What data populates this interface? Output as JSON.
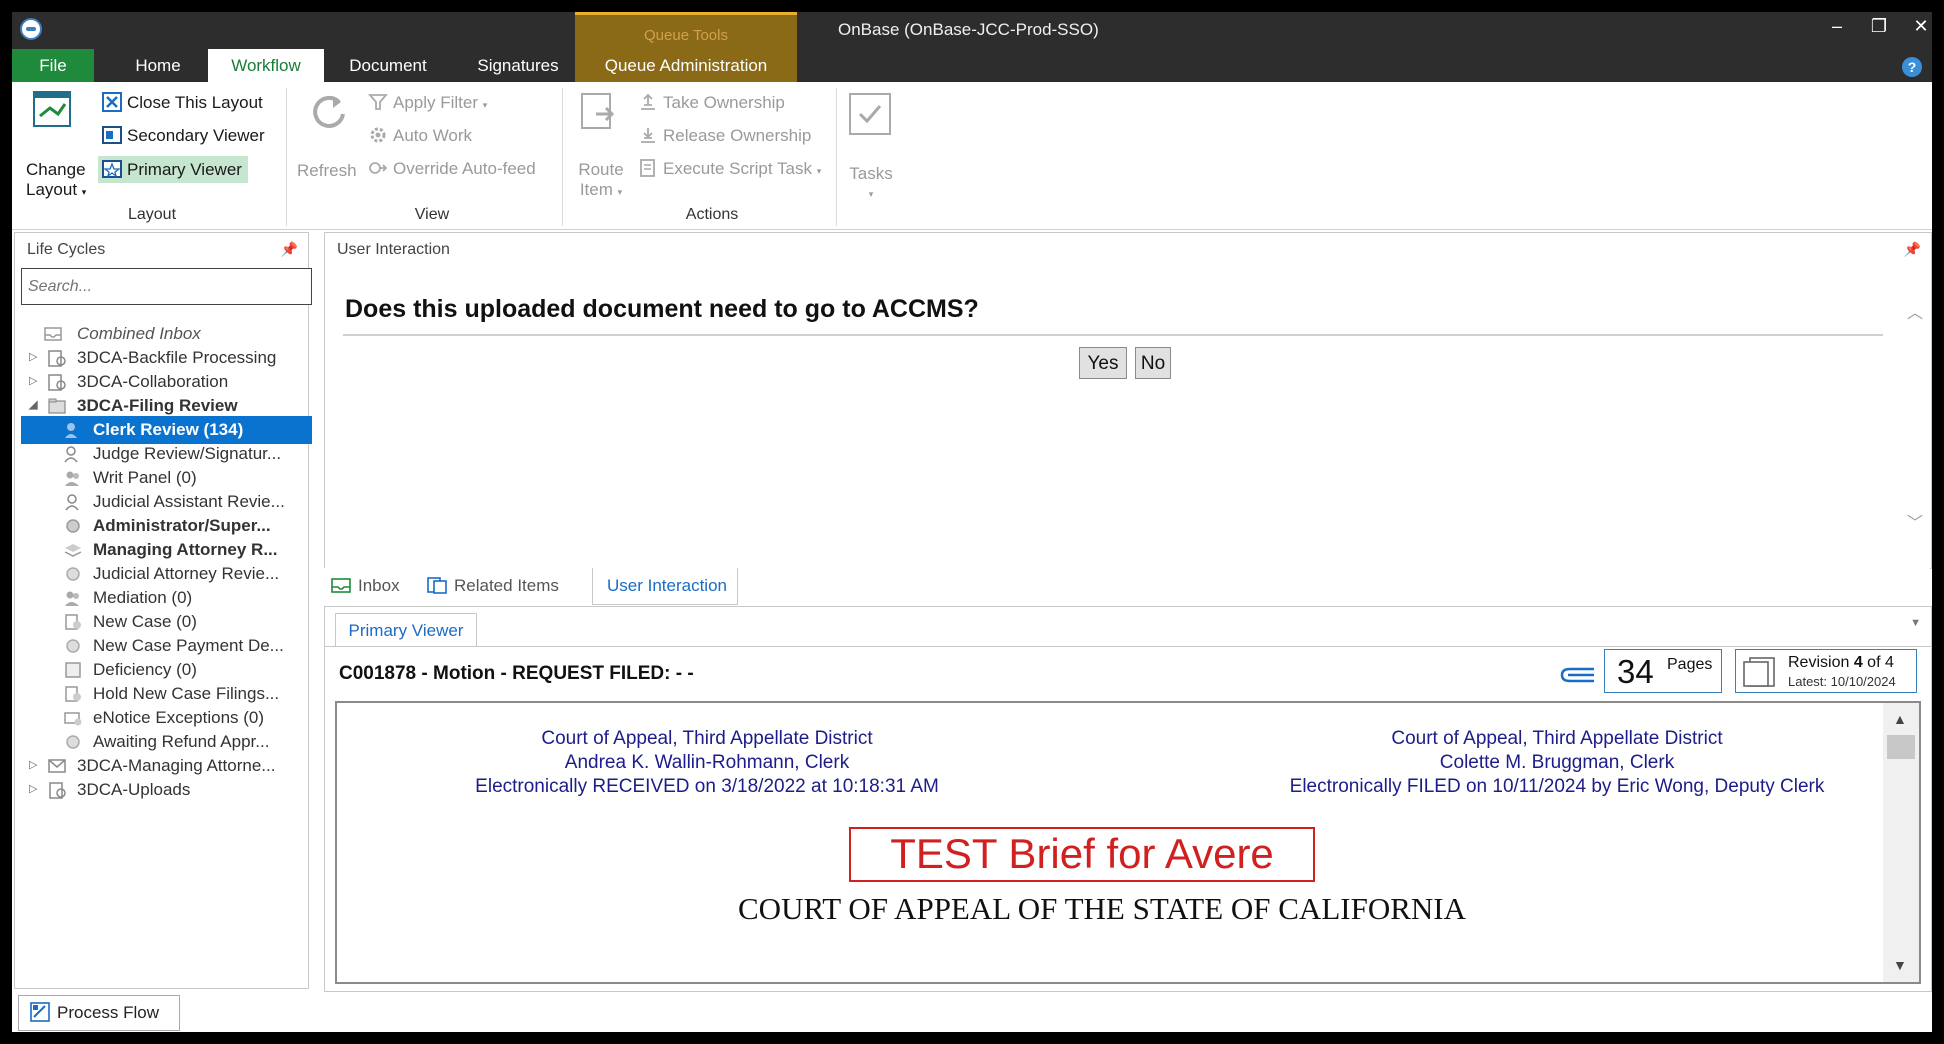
{
  "window": {
    "title": "OnBase (OnBase-JCC-Prod-SSO)",
    "context_group": "Queue Tools",
    "controls": {
      "minimize": "–",
      "restore": "❐",
      "close": "✕"
    }
  },
  "tabs": {
    "file": "File",
    "home": "Home",
    "workflow": "Workflow",
    "document": "Document",
    "signatures": "Signatures",
    "queue_admin": "Queue Administration",
    "help": "?"
  },
  "ribbon": {
    "layout": {
      "change_layout_1": "Change",
      "change_layout_2": "Layout",
      "close_layout": "Close This Layout",
      "secondary_viewer": "Secondary Viewer",
      "primary_viewer": "Primary Viewer",
      "group": "Layout"
    },
    "view": {
      "refresh": "Refresh",
      "apply_filter": "Apply Filter",
      "auto_work": "Auto Work",
      "override_autofeed": "Override Auto-feed",
      "group": "View"
    },
    "actions": {
      "route_item_1": "Route",
      "route_item_2": "Item",
      "take_ownership": "Take Ownership",
      "release_ownership": "Release Ownership",
      "execute_script": "Execute Script Task",
      "tasks": "Tasks",
      "group": "Actions"
    }
  },
  "lifecycles": {
    "header": "Life Cycles",
    "search_placeholder": "Search...",
    "items": [
      {
        "label": "Combined Inbox"
      },
      {
        "label": "3DCA-Backfile Processing"
      },
      {
        "label": "3DCA-Collaboration"
      },
      {
        "label": "3DCA-Filing Review"
      },
      {
        "label": "Clerk Review (134)"
      },
      {
        "label": "Judge Review/Signatur..."
      },
      {
        "label": "Writ Panel (0)"
      },
      {
        "label": "Judicial Assistant Revie..."
      },
      {
        "label": "Administrator/Super..."
      },
      {
        "label": "Managing Attorney R..."
      },
      {
        "label": "Judicial Attorney Revie..."
      },
      {
        "label": "Mediation (0)"
      },
      {
        "label": "New Case (0)"
      },
      {
        "label": "New Case Payment De..."
      },
      {
        "label": "Deficiency (0)"
      },
      {
        "label": "Hold New Case Filings..."
      },
      {
        "label": "eNotice Exceptions (0)"
      },
      {
        "label": "Awaiting Refund Appr..."
      },
      {
        "label": "3DCA-Managing Attorne..."
      },
      {
        "label": "3DCA-Uploads"
      }
    ]
  },
  "user_interaction": {
    "header": "User Interaction",
    "question": "Does this uploaded document need to go to ACCMS?",
    "yes": "Yes",
    "no": "No"
  },
  "mid_tabs": {
    "inbox": "Inbox",
    "related": "Related Items",
    "user_interaction": "User Interaction"
  },
  "viewer": {
    "tab": "Primary Viewer",
    "doc_title": "C001878 - Motion - REQUEST FILED: -  -",
    "pages_count": "34",
    "pages_label": "Pages",
    "revision_prefix": "Revision ",
    "revision_num": "4",
    "revision_suffix": " of 4",
    "revision_latest": "Latest: 10/10/2024",
    "stamp_left": [
      "Court of Appeal, Third Appellate District",
      "Andrea K. Wallin-Rohmann, Clerk",
      "Electronically RECEIVED on 3/18/2022 at 10:18:31 AM"
    ],
    "stamp_right": [
      "Court of Appeal, Third Appellate District",
      "Colette M. Bruggman, Clerk",
      "Electronically FILED on 10/11/2024 by Eric Wong, Deputy Clerk"
    ],
    "test_title": "TEST Brief for Avere",
    "court_heading": "COURT OF APPEAL OF THE STATE OF CALIFORNIA"
  },
  "footer": {
    "process_flow": "Process Flow"
  },
  "colors": {
    "accent_green": "#1f8a3c",
    "selection_blue": "#0a73d0",
    "queue_tools_gold": "#8a6a17",
    "stamp_blue": "#1c1c8a",
    "test_red": "#d02020"
  }
}
